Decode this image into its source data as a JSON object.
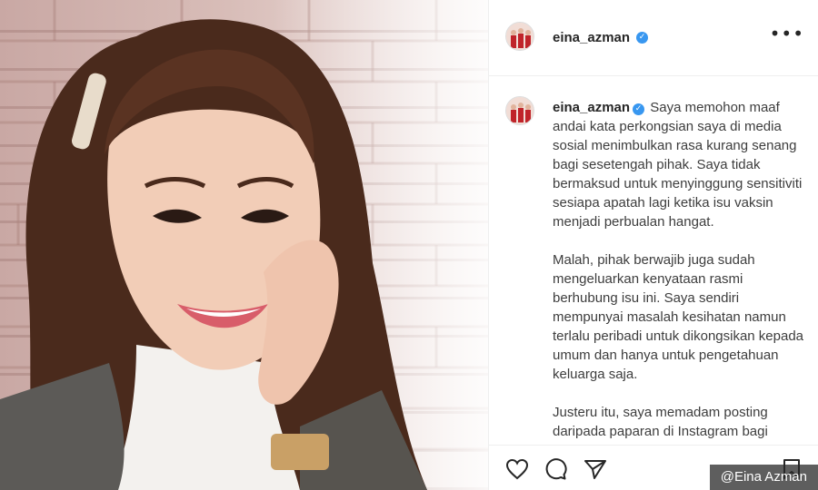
{
  "photo": {
    "alt": "Photo of a smiling woman with hand on cheek in front of a brick wall"
  },
  "post": {
    "header": {
      "username": "eina_azman",
      "verified_icon": "✓",
      "more_icon": "•••"
    },
    "caption": {
      "username": "eina_azman",
      "verified_icon": "✓",
      "paragraphs": [
        "Saya memohon maaf andai kata perkongsian saya di media sosial menimbulkan rasa kurang senang bagi sesetengah pihak. Saya tidak bermaksud untuk menyinggung sensitiviti sesiapa apatah lagi ketika isu vaksin menjadi perbualan hangat.",
        "Malah, pihak berwajib juga sudah mengeluarkan kenyataan rasmi berhubung isu ini. Saya sendiri mempunyai masalah kesihatan namun terlalu peribadi untuk dikongsikan kepada umum dan hanya untuk pengetahuan keluarga saja.",
        "Justeru itu, saya memadam posting daripada paparan di Instagram bagi mengelakkan isu ini daripada bertambah rumit."
      ]
    },
    "actions": {
      "like_icon": "heart-icon",
      "comment_icon": "comment-icon",
      "share_icon": "paper-plane-icon",
      "save_icon": "bookmark-icon"
    }
  },
  "watermark": "@Eina Azman"
}
